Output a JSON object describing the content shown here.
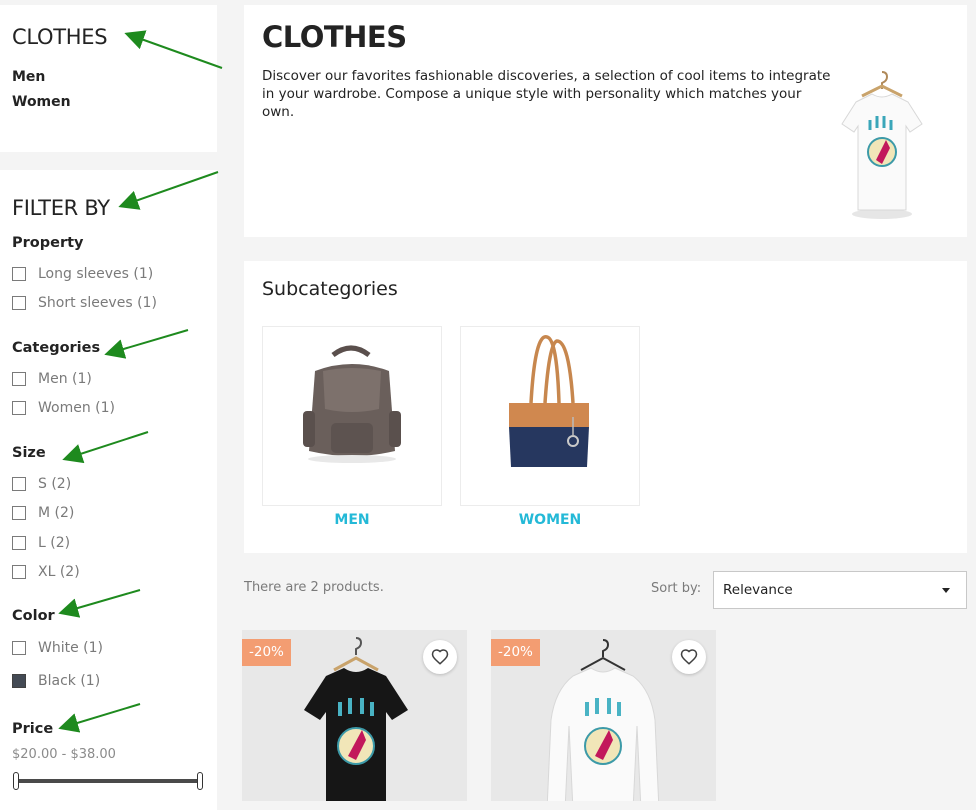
{
  "sidebar": {
    "category_block": {
      "title": "CLOTHES",
      "links": [
        "Men",
        "Women"
      ]
    },
    "filters": {
      "title": "FILTER BY",
      "property": {
        "title": "Property",
        "options": [
          "Long sleeves (1)",
          "Short sleeves (1)"
        ]
      },
      "categories": {
        "title": "Categories",
        "options": [
          "Men (1)",
          "Women (1)"
        ]
      },
      "size": {
        "title": "Size",
        "options": [
          "S (2)",
          "M (2)",
          "L (2)",
          "XL (2)"
        ]
      },
      "color": {
        "title": "Color",
        "options": [
          {
            "label": "White (1)",
            "swatch": "#ffffff"
          },
          {
            "label": "Black (1)",
            "swatch": "#434a54"
          }
        ]
      },
      "price": {
        "title": "Price",
        "range": "$20.00 - $38.00",
        "slider_min": 0,
        "slider_max": 1
      }
    }
  },
  "category": {
    "title": "CLOTHES",
    "description": "Discover our favorites fashionable discoveries, a selection of cool items to integrate in your wardrobe. Compose a unique style with personality which matches your own.",
    "image_icon": "tshirt-image"
  },
  "subcategories": {
    "title": "Subcategories",
    "items": [
      {
        "name": "MEN",
        "image_icon": "backpack-image"
      },
      {
        "name": "WOMEN",
        "image_icon": "tote-bag-image"
      }
    ]
  },
  "products_bar": {
    "count_text": "There are 2 products.",
    "sort_label": "Sort by:",
    "sort_value": "Relevance"
  },
  "products": [
    {
      "badge": "-20%",
      "image_icon": "black-tshirt-image",
      "wishlist_icon": "heart-icon"
    },
    {
      "badge": "-20%",
      "image_icon": "white-longsleeve-image",
      "wishlist_icon": "heart-icon"
    }
  ],
  "colors": {
    "accent": "#24b9d7",
    "badge": "#f39d72",
    "annotation_arrow": "#1e8a1e"
  }
}
